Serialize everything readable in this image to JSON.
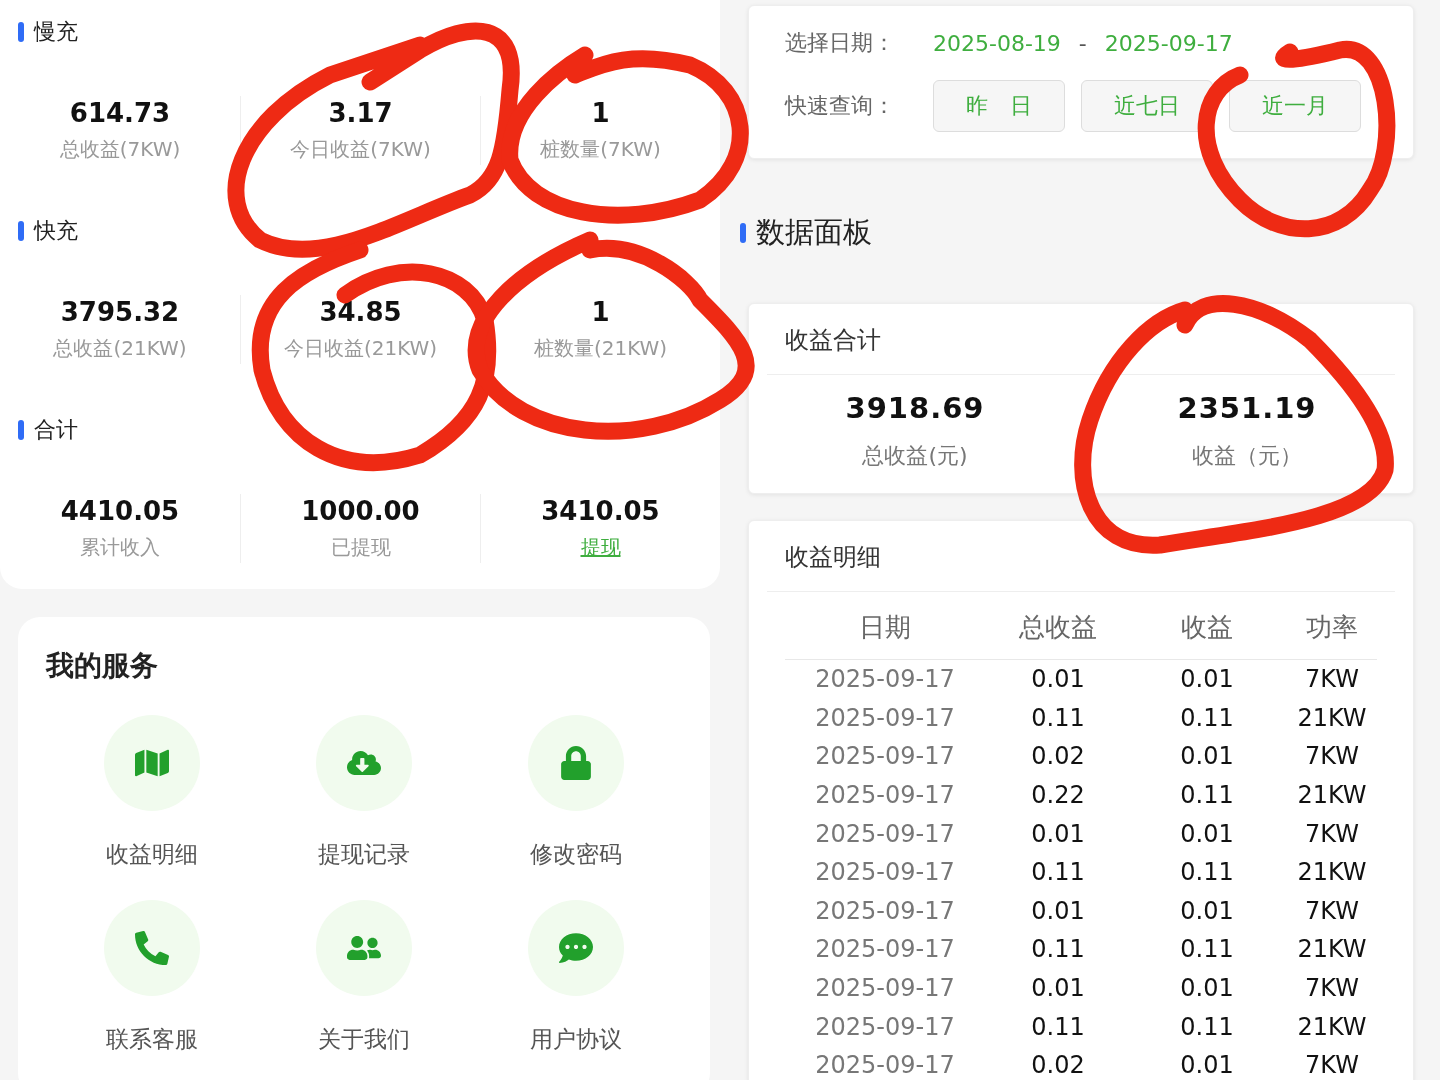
{
  "summary_sections": [
    {
      "title": "慢充",
      "stats": [
        {
          "value": "614.73",
          "label": "总收益(7KW)",
          "kind": "plain"
        },
        {
          "value": "3.17",
          "label": "今日收益(7KW)",
          "kind": "plain"
        },
        {
          "value": "1",
          "label": "桩数量(7KW)",
          "kind": "plain"
        }
      ]
    },
    {
      "title": "快充",
      "stats": [
        {
          "value": "3795.32",
          "label": "总收益(21KW)",
          "kind": "plain"
        },
        {
          "value": "34.85",
          "label": "今日收益(21KW)",
          "kind": "plain"
        },
        {
          "value": "1",
          "label": "桩数量(21KW)",
          "kind": "plain"
        }
      ]
    },
    {
      "title": "合计",
      "stats": [
        {
          "value": "4410.05",
          "label": "累计收入",
          "kind": "plain"
        },
        {
          "value": "1000.00",
          "label": "已提现",
          "kind": "plain"
        },
        {
          "value": "3410.05",
          "label": "提现",
          "kind": "link"
        }
      ]
    }
  ],
  "services": {
    "title": "我的服务",
    "items": [
      {
        "label": "收益明细"
      },
      {
        "label": "提现记录"
      },
      {
        "label": "修改密码"
      },
      {
        "label": "联系客服"
      },
      {
        "label": "关于我们"
      },
      {
        "label": "用户协议"
      }
    ]
  },
  "date_filter": {
    "label": "选择日期：",
    "start": "2025-08-19",
    "separator": "-",
    "end": "2025-09-17",
    "quick_label": "快速查询：",
    "quick_buttons": [
      "昨　日",
      "近七日",
      "近一月"
    ]
  },
  "dashboard": {
    "title": "数据面板",
    "totals": {
      "title": "收益合计",
      "stats": [
        {
          "value": "3918.69",
          "label": "总收益(元)"
        },
        {
          "value": "2351.19",
          "label": "收益（元）"
        }
      ]
    },
    "details": {
      "title": "收益明细",
      "columns": [
        "日期",
        "总收益",
        "收益",
        "功率"
      ],
      "rows": [
        [
          "2025-09-17",
          "0.01",
          "0.01",
          "7KW"
        ],
        [
          "2025-09-17",
          "0.11",
          "0.11",
          "21KW"
        ],
        [
          "2025-09-17",
          "0.02",
          "0.01",
          "7KW"
        ],
        [
          "2025-09-17",
          "0.22",
          "0.11",
          "21KW"
        ],
        [
          "2025-09-17",
          "0.01",
          "0.01",
          "7KW"
        ],
        [
          "2025-09-17",
          "0.11",
          "0.11",
          "21KW"
        ],
        [
          "2025-09-17",
          "0.01",
          "0.01",
          "7KW"
        ],
        [
          "2025-09-17",
          "0.11",
          "0.11",
          "21KW"
        ],
        [
          "2025-09-17",
          "0.01",
          "0.01",
          "7KW"
        ],
        [
          "2025-09-17",
          "0.11",
          "0.11",
          "21KW"
        ],
        [
          "2025-09-17",
          "0.02",
          "0.01",
          "7KW"
        ]
      ]
    }
  }
}
